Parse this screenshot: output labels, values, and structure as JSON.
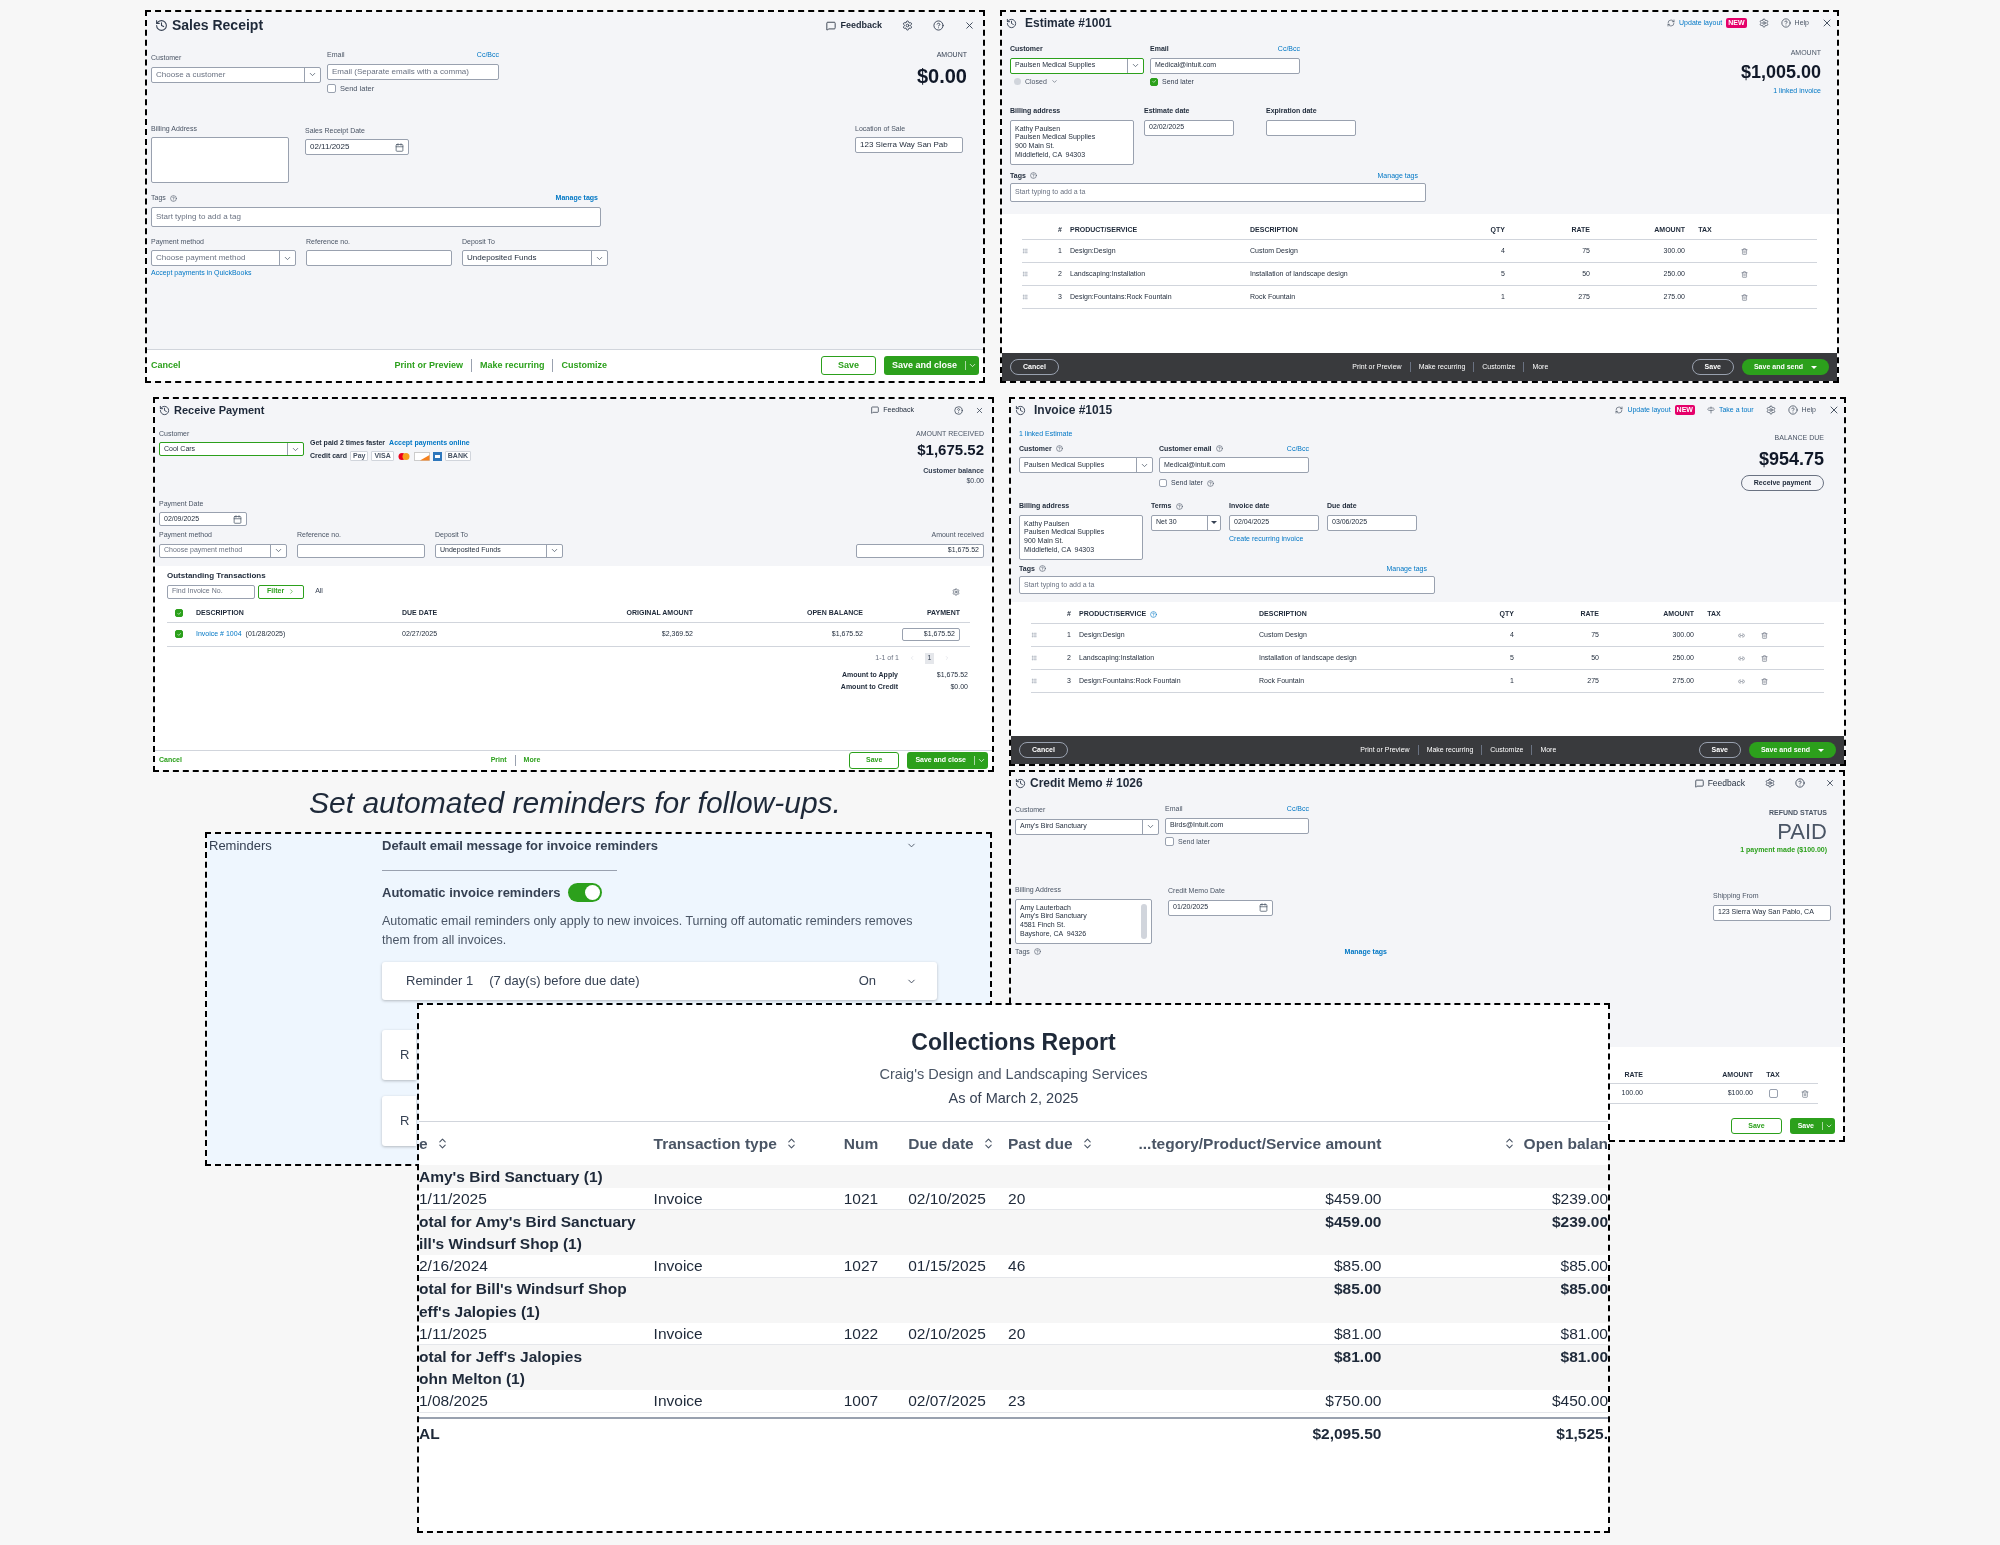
{
  "sales_receipt": {
    "title": "Sales Receipt",
    "feedback": "Feedback",
    "customer": {
      "label": "Customer",
      "placeholder": "Choose a customer",
      "kind": "select"
    },
    "email": {
      "label": "Email",
      "placeholder": "Email (Separate emails with a comma)",
      "cc_bcc": "Cc/Bcc"
    },
    "send_later": {
      "label": "Send later",
      "checked": false
    },
    "amount_label": "AMOUNT",
    "amount": "$0.00",
    "billing_address": {
      "label": "Billing Address"
    },
    "date": {
      "label": "Sales Receipt Date",
      "value": "02/11/2025",
      "kind": "date"
    },
    "location": {
      "label": "Location of Sale",
      "value": "123 Sierra Way San Pab"
    },
    "tags": {
      "label": "Tags",
      "placeholder": "Start typing to add a tag",
      "manage": "Manage tags"
    },
    "payment_method": {
      "label": "Payment method",
      "placeholder": "Choose payment method",
      "kind": "select"
    },
    "reference": {
      "label": "Reference no."
    },
    "deposit_to": {
      "label": "Deposit To",
      "value": "Undeposited Funds",
      "kind": "select"
    },
    "accept_link": "Accept payments in QuickBooks",
    "footer": {
      "cancel": "Cancel",
      "links": [
        "Print or Preview",
        "Make recurring",
        "Customize"
      ],
      "save": "Save",
      "save_primary": "Save and close"
    }
  },
  "estimate": {
    "title": "Estimate #1001",
    "update_layout": "Update layout",
    "new_badge": "NEW",
    "help": "Help",
    "customer": {
      "label": "Customer",
      "value": "Paulsen Medical Supplies",
      "kind": "select",
      "focused": true
    },
    "status": "Closed",
    "email": {
      "label": "Email",
      "value": "Medical@intuit.com",
      "cc_bcc": "Cc/Bcc"
    },
    "send_later": {
      "label": "Send later",
      "checked": true
    },
    "amount_label": "AMOUNT",
    "amount": "$1,005.00",
    "linked": "1 linked invoice",
    "billing_address": {
      "label": "Billing address",
      "lines": [
        "Kathy Paulsen",
        "Paulsen Medical Supplies",
        "900 Main St.",
        "Middlefield, CA  94303"
      ]
    },
    "estimate_date": {
      "label": "Estimate date",
      "value": "02/02/2025"
    },
    "expiration_date": {
      "label": "Expiration date"
    },
    "tags": {
      "label": "Tags",
      "placeholder": "Start typing to add a ta",
      "manage": "Manage tags"
    },
    "table": {
      "columns": [
        "#",
        "PRODUCT/SERVICE",
        "DESCRIPTION",
        "QTY",
        "RATE",
        "AMOUNT",
        "TAX"
      ],
      "rows": [
        {
          "num": "1",
          "product": "Design:Design",
          "description": "Custom Design",
          "qty": "4",
          "rate": "75",
          "amount": "300.00"
        },
        {
          "num": "2",
          "product": "Landscaping:Installation",
          "description": "Installation of landscape design",
          "qty": "5",
          "rate": "50",
          "amount": "250.00"
        },
        {
          "num": "3",
          "product": "Design:Fountains:Rock Fountain",
          "description": "Rock Fountain",
          "qty": "1",
          "rate": "275",
          "amount": "275.00"
        }
      ]
    },
    "footer": {
      "cancel": "Cancel",
      "links": [
        "Print or Preview",
        "Make recurring",
        "Customize",
        "More"
      ],
      "save": "Save",
      "save_primary": "Save and send"
    }
  },
  "receive_payment": {
    "title": "Receive Payment",
    "feedback": "Feedback",
    "customer": {
      "label": "Customer",
      "value": "Cool Cars",
      "kind": "select",
      "focused": true
    },
    "promo": "Get paid 2 times faster",
    "accept_link": "Accept payments online",
    "credit_card": "Credit card",
    "card_badges": [
      {
        "kind": "text",
        "label": "Pay"
      },
      {
        "kind": "text",
        "label": "VISA"
      },
      {
        "kind": "mastercard"
      },
      {
        "kind": "discover"
      },
      {
        "kind": "amex"
      },
      {
        "kind": "text",
        "label": "BANK"
      }
    ],
    "amount_label": "AMOUNT RECEIVED",
    "amount": "$1,675.52",
    "balance_label": "Customer balance",
    "balance": "$0.00",
    "payment_date": {
      "label": "Payment Date",
      "value": "02/09/2025",
      "kind": "date"
    },
    "payment_method": {
      "label": "Payment method",
      "placeholder": "Choose payment method",
      "kind": "select"
    },
    "reference": {
      "label": "Reference no."
    },
    "deposit_to": {
      "label": "Deposit To",
      "value": "Undeposited Funds",
      "kind": "select"
    },
    "amount_received": {
      "label": "Amount received",
      "value": "$1,675.52"
    },
    "outstanding": "Outstanding Transactions",
    "find": {
      "placeholder": "Find Invoice No."
    },
    "filter": "Filter",
    "all": "All",
    "table": {
      "all_checked": true,
      "columns": [
        "DESCRIPTION",
        "DUE DATE",
        "ORIGINAL AMOUNT",
        "OPEN BALANCE",
        "PAYMENT"
      ],
      "rows": [
        {
          "checked": true,
          "invoice": "Invoice # 1004",
          "invoice_date": "(01/28/2025)",
          "due": "02/27/2025",
          "original": "$2,369.52",
          "open": "$1,675.52",
          "payment": "$1,675.52"
        }
      ]
    },
    "pagination": {
      "range": "1-1 of 1",
      "pages": [
        {
          "label": "1",
          "selected": true
        }
      ]
    },
    "amount_to_apply": {
      "label": "Amount to Apply",
      "value": "$1,675.52"
    },
    "amount_to_credit": {
      "label": "Amount to Credit",
      "value": "$0.00"
    },
    "footer": {
      "cancel": "Cancel",
      "links": [
        "Print",
        "More"
      ],
      "save": "Save",
      "save_primary": "Save and close"
    }
  },
  "invoice": {
    "title": "Invoice #1015",
    "update_layout": "Update layout",
    "new_badge": "NEW",
    "take_tour": "Take a tour",
    "help": "Help",
    "linked_estimate": "1 linked Estimate",
    "customer": {
      "label": "Customer",
      "value": "Paulsen Medical Supplies",
      "kind": "select"
    },
    "email": {
      "label": "Customer email",
      "value": "Medical@intuit.com",
      "cc_bcc": "Cc/Bcc"
    },
    "send_later": {
      "label": "Send later",
      "checked": false
    },
    "balance_label": "BALANCE DUE",
    "balance": "$954.75",
    "receive_payment": "Receive payment",
    "billing_address": {
      "label": "Billing address",
      "lines": [
        "Kathy Paulsen",
        "Paulsen Medical Supplies",
        "900 Main St.",
        "Middlefield, CA  94303"
      ]
    },
    "terms": {
      "label": "Terms",
      "value": "Net 30",
      "kind": "caret"
    },
    "invoice_date": {
      "label": "Invoice date",
      "value": "02/04/2025"
    },
    "create_recurring": "Create recurring invoice",
    "due_date": {
      "label": "Due date",
      "value": "03/06/2025"
    },
    "tags": {
      "label": "Tags",
      "placeholder": "Start typing to add a ta",
      "manage": "Manage tags"
    },
    "table": {
      "columns": [
        "#",
        "PRODUCT/SERVICE",
        "DESCRIPTION",
        "QTY",
        "RATE",
        "AMOUNT",
        "TAX"
      ],
      "rows": [
        {
          "num": "1",
          "product": "Design:Design",
          "description": "Custom Design",
          "qty": "4",
          "rate": "75",
          "amount": "300.00"
        },
        {
          "num": "2",
          "product": "Landscaping:Installation",
          "description": "Installation of landscape design",
          "qty": "5",
          "rate": "50",
          "amount": "250.00"
        },
        {
          "num": "3",
          "product": "Design:Fountains:Rock Fountain",
          "description": "Rock Fountain",
          "qty": "1",
          "rate": "275",
          "amount": "275.00"
        }
      ]
    },
    "footer": {
      "cancel": "Cancel",
      "links": [
        "Print or Preview",
        "Make recurring",
        "Customize",
        "More"
      ],
      "save": "Save",
      "save_primary": "Save and send"
    }
  },
  "caption": "Set automated reminders for follow-ups.",
  "reminders": {
    "sidebar_label": "Reminders",
    "default_message": "Default email message for invoice reminders",
    "auto_label": "Automatic invoice reminders",
    "auto_on": true,
    "note": "Automatic email reminders only apply to new invoices. Turning off automatic reminders removes them from all invoices.",
    "items": [
      {
        "label": "Reminder 1",
        "detail": "(7 day(s) before due date)",
        "status": "On"
      },
      {
        "label": "R"
      },
      {
        "label": "R"
      }
    ]
  },
  "credit_memo": {
    "title": "Credit Memo # 1026",
    "feedback": "Feedback",
    "customer": {
      "label": "Customer",
      "value": "Amy's Bird Sanctuary",
      "kind": "select"
    },
    "email": {
      "label": "Email",
      "value": "Birds@Intuit.com",
      "cc_bcc": "Cc/Bcc"
    },
    "send_later": {
      "label": "Send later",
      "checked": false
    },
    "refund_label": "REFUND STATUS",
    "refund_status": "PAID",
    "payment_note": "1 payment made ($100.00)",
    "billing_address": {
      "label": "Billing Address",
      "lines": [
        "Amy Lauterbach",
        "Amy's Bird Sanctuary",
        "4581 Finch St.",
        "Bayshore, CA  94326"
      ]
    },
    "date": {
      "label": "Credit Memo Date",
      "value": "01/20/2025",
      "kind": "date"
    },
    "shipping_from": {
      "label": "Shipping From",
      "value": "123 Sierra Way San Pablo, CA"
    },
    "tags": {
      "label": "Tags",
      "manage": "Manage tags"
    },
    "table": {
      "columns": [
        "RATE",
        "AMOUNT",
        "TAX"
      ],
      "row": {
        "rate": "100.00",
        "amount": "$100.00",
        "tax": false
      }
    },
    "footer": {
      "save": "Save",
      "save_primary": "Save"
    }
  },
  "collections": {
    "title": "Collections Report",
    "company": "Craig's Design and Landscaping Services",
    "as_of": "As of March 2, 2025",
    "columns": [
      {
        "label": "e",
        "sortable": true
      },
      {
        "label": "Transaction type",
        "sortable": true
      },
      {
        "label": "Num",
        "sortable": false
      },
      {
        "label": "Due date",
        "sortable": true
      },
      {
        "label": "Past due",
        "sortable": true
      },
      {
        "label": "...tegory/Product/Service amount",
        "sortable": false
      },
      {
        "label": "Open balan",
        "sortable": true
      }
    ],
    "rows": [
      {
        "kind": "group",
        "label": "Amy's Bird Sanctuary (1)"
      },
      {
        "kind": "row",
        "cells": [
          "1/11/2025",
          "Invoice",
          "1021",
          "02/10/2025",
          "20",
          "$459.00",
          "$239.00"
        ]
      },
      {
        "kind": "total",
        "label": "otal for Amy's Bird Sanctuary",
        "amount": "$459.00",
        "open": "$239.00"
      },
      {
        "kind": "group",
        "label": "ill's Windsurf Shop (1)"
      },
      {
        "kind": "row",
        "cells": [
          "2/16/2024",
          "Invoice",
          "1027",
          "01/15/2025",
          "46",
          "$85.00",
          "$85.00"
        ]
      },
      {
        "kind": "total",
        "label": "otal for Bill's Windsurf Shop",
        "amount": "$85.00",
        "open": "$85.00"
      },
      {
        "kind": "group",
        "label": "eff's Jalopies (1)"
      },
      {
        "kind": "row",
        "cells": [
          "1/11/2025",
          "Invoice",
          "1022",
          "02/10/2025",
          "20",
          "$81.00",
          "$81.00"
        ]
      },
      {
        "kind": "total",
        "label": "otal for Jeff's Jalopies",
        "amount": "$81.00",
        "open": "$81.00"
      },
      {
        "kind": "group",
        "label": "ohn Melton (1)"
      },
      {
        "kind": "row",
        "cells": [
          "1/08/2025",
          "Invoice",
          "1007",
          "02/07/2025",
          "23",
          "$750.00",
          "$450.00"
        ]
      },
      {
        "kind": "grand_total",
        "label": "AL",
        "amount": "$2,095.50",
        "open": "$1,525."
      }
    ]
  }
}
